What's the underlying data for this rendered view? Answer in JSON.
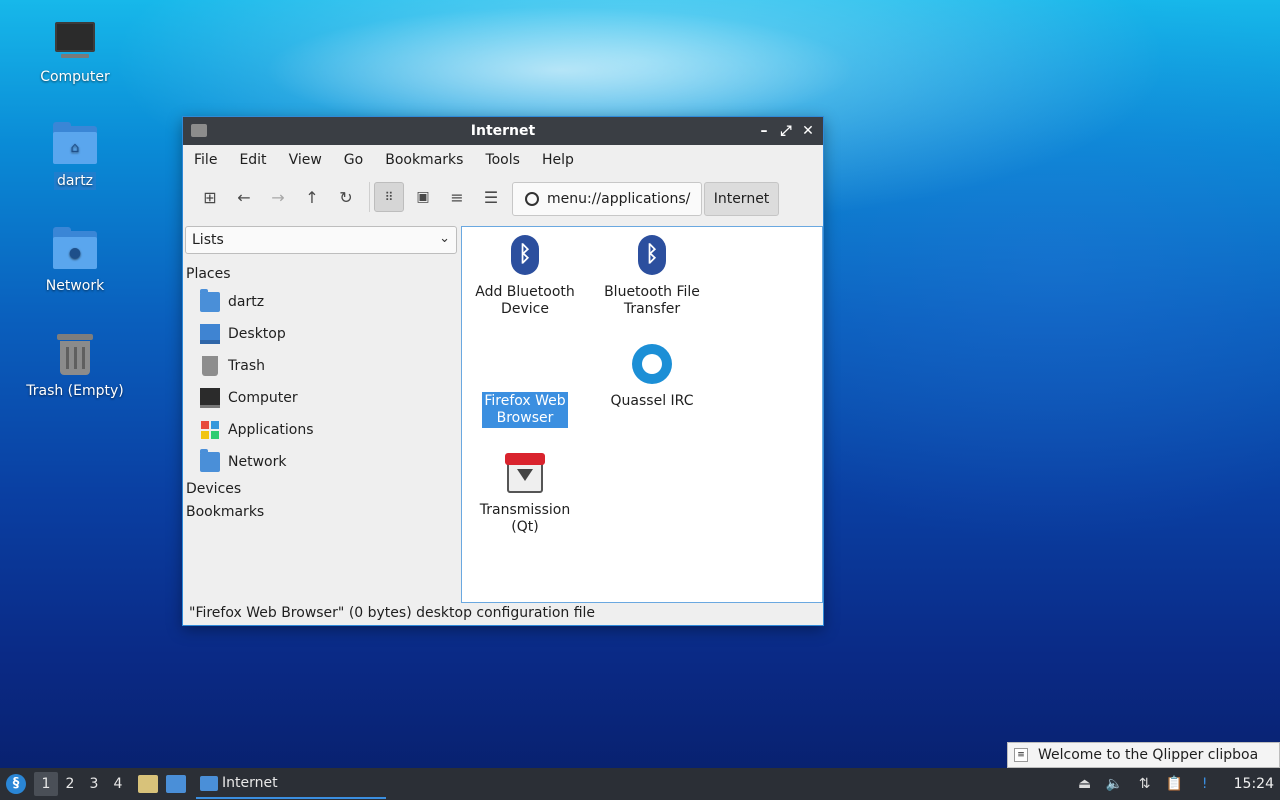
{
  "desktop": {
    "icons": [
      {
        "label": "Computer"
      },
      {
        "label": "dartz"
      },
      {
        "label": "Network"
      },
      {
        "label": "Trash (Empty)"
      }
    ]
  },
  "window": {
    "title": "Internet",
    "controls": {
      "minimize": "–",
      "maximize": "⤢",
      "close": "✕"
    },
    "menu": [
      "File",
      "Edit",
      "View",
      "Go",
      "Bookmarks",
      "Tools",
      "Help"
    ],
    "toolbar": {
      "icons": [
        "new-tab-icon",
        "back-arrow-icon",
        "forward-arrow-icon",
        "up-arrow-icon",
        "reload-icon",
        "icon-view-icon",
        "thumbnail-view-icon",
        "compact-view-icon",
        "detailed-list-icon"
      ],
      "path": "menu://applications/",
      "breadcrumb": "Internet"
    },
    "sidebar": {
      "mode": "Lists",
      "places_header": "Places",
      "places": [
        "dartz",
        "Desktop",
        "Trash",
        "Computer",
        "Applications",
        "Network"
      ],
      "devices_header": "Devices",
      "bookmarks_header": "Bookmarks"
    },
    "files": [
      {
        "line1": "Add Bluetooth",
        "line2": "Device",
        "icon": "bluetooth-icon"
      },
      {
        "line1": "Bluetooth File",
        "line2": "Transfer",
        "icon": "bluetooth-icon"
      },
      {
        "line1": "Firefox Web",
        "line2": "Browser",
        "icon": "firefox-icon",
        "selected": true
      },
      {
        "line1": "Quassel IRC",
        "line2": "",
        "icon": "quassel-icon"
      },
      {
        "line1": "Transmission",
        "line2": "(Qt)",
        "icon": "transmission-icon"
      }
    ],
    "status": "\"Firefox Web Browser\" (0 bytes) desktop configuration file"
  },
  "notification": {
    "text": "Welcome to the Qlipper clipboa"
  },
  "taskbar": {
    "desktops": [
      "1",
      "2",
      "3",
      "4"
    ],
    "task_label": "Internet",
    "clock": "15:24",
    "accent": "#3b8fe0"
  }
}
